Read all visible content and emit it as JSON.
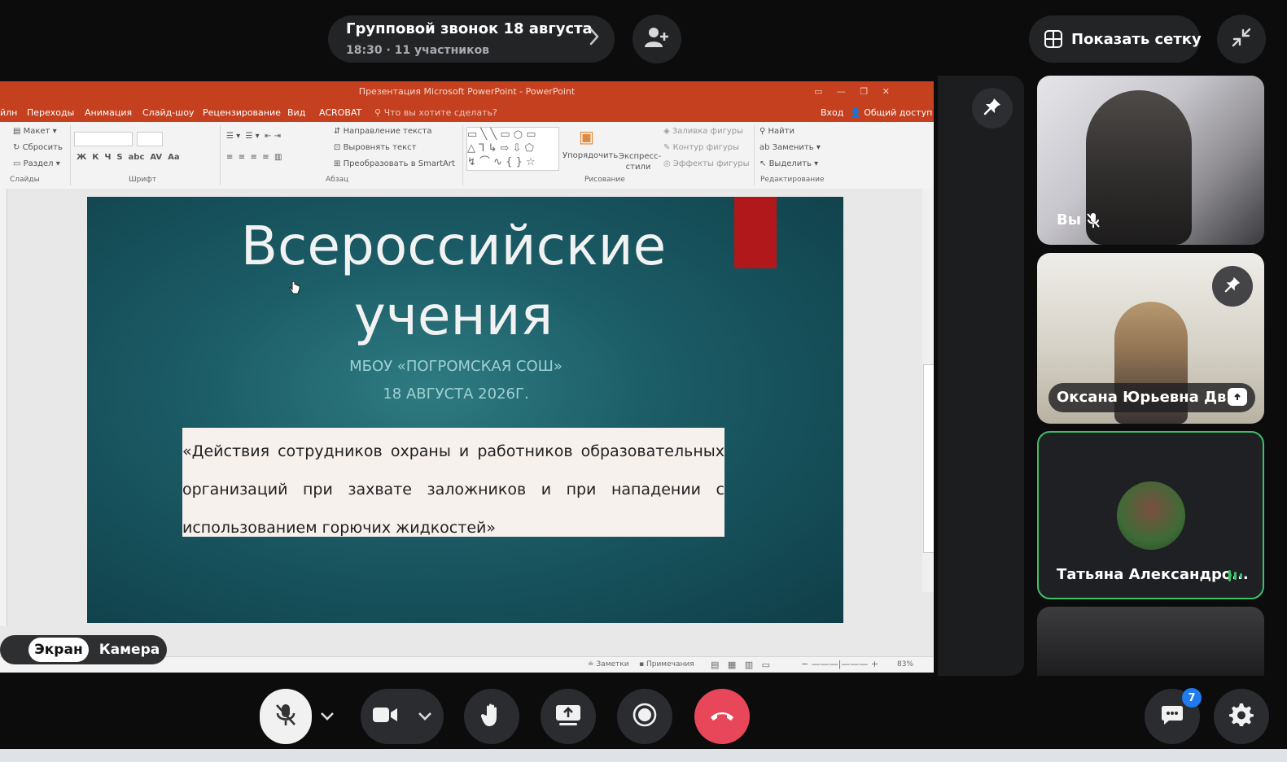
{
  "call": {
    "title": "Групповой звонок 18 августа",
    "subtitle": "18:30 · 11 участников"
  },
  "header": {
    "show_grid_label": "Показать сетку"
  },
  "ppt": {
    "window_title": "Презентация Microsoft PowerPoint - PowerPoint",
    "menu": [
      "йлн",
      "Переходы",
      "Анимация",
      "Слайд-шоу",
      "Рецензирование",
      "Вид",
      "ACROBAT",
      "Что вы хотите сделать?"
    ],
    "login": "Вход",
    "share": "Общий доступ",
    "ribbon": {
      "layout": "Макет",
      "reset": "Сбросить",
      "section": "Раздел",
      "text_direction": "Направление текста",
      "align_text": "Выровнять текст",
      "smartart": "Преобразовать в SmartArt",
      "arrange": "Упорядочить",
      "express_styles": "Экспресс-стили",
      "shape_fill": "Заливка фигуры",
      "shape_outline": "Контур фигуры",
      "shape_effects": "Эффекты фигуры",
      "find": "Найти",
      "replace": "Заменить",
      "select": "Выделить",
      "groups": [
        "Слайды",
        "Шрифт",
        "Абзац",
        "Рисование",
        "Редактирование"
      ]
    },
    "status": {
      "notes": "Заметки",
      "comments": "Примечания",
      "zoom": "83%"
    }
  },
  "slide": {
    "title_line1": "Всероссийские",
    "title_line2": "учения",
    "school": "МБОУ «ПОГРОМСКАЯ СОШ»",
    "date": "18 АВГУСТА 2026Г.",
    "body": "«Действия сотрудников охраны и работников образовательных организаций при захвате заложников и при нападении с использованием горючих жидкостей»"
  },
  "source_toggle": {
    "screen": "Экран",
    "camera": "Камера"
  },
  "participants": [
    {
      "name": "Вы",
      "muted": true
    },
    {
      "name": "Оксана Юрьевна Дв...",
      "sharing": true
    },
    {
      "name": "Татьяна Александро...",
      "speaking": true
    }
  ],
  "chat_badge": "7",
  "colors": {
    "accent_green": "#3fbf6a",
    "end_call": "#e8475a",
    "badge_blue": "#1e7bf0",
    "ppt_orange": "#c5401f"
  },
  "icons": [
    "add-user-icon",
    "grid-icon",
    "collapse-icon",
    "pin-icon",
    "mic-off-icon",
    "camera-icon",
    "hand-icon",
    "share-screen-icon",
    "record-icon",
    "end-call-icon",
    "chat-icon",
    "gear-icon"
  ]
}
